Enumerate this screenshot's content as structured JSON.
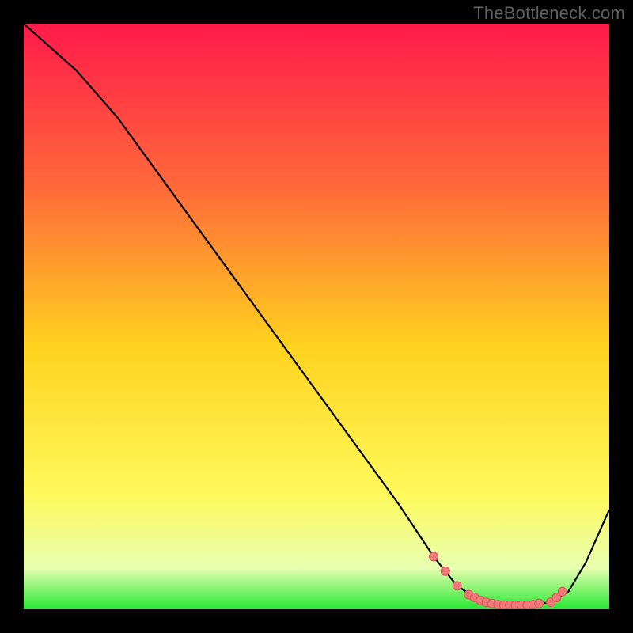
{
  "watermark": "TheBottleneck.com",
  "colors": {
    "gradient_top": "#ff1a4a",
    "gradient_mid_upper": "#ff6a3a",
    "gradient_mid": "#ffd21f",
    "gradient_lower": "#fff95a",
    "gradient_band_light": "#e7ffb0",
    "gradient_bottom": "#27e833",
    "curve": "#000000",
    "marker_fill": "#f07878",
    "marker_stroke": "#d85a5a"
  },
  "chart_data": {
    "type": "line",
    "title": "",
    "xlabel": "",
    "ylabel": "",
    "xlim": [
      0,
      100
    ],
    "ylim": [
      0,
      100
    ],
    "series": [
      {
        "name": "curve",
        "x": [
          0,
          9,
          16,
          24,
          32,
          40,
          48,
          56,
          64,
          70,
          74,
          78,
          82,
          86,
          90,
          93,
          96,
          100
        ],
        "y": [
          100,
          92,
          84,
          73,
          62,
          51,
          40,
          29,
          18,
          9,
          4,
          1.5,
          0.7,
          0.7,
          1.2,
          3,
          8,
          17
        ]
      }
    ],
    "markers": {
      "name": "highlight-points",
      "x": [
        70,
        72,
        74,
        76,
        77,
        78,
        79,
        80,
        81,
        82,
        83,
        84,
        85,
        86,
        87,
        88,
        90,
        91,
        92
      ],
      "y": [
        9,
        6.5,
        4,
        2.5,
        2,
        1.5,
        1.2,
        1,
        0.8,
        0.7,
        0.7,
        0.7,
        0.7,
        0.7,
        0.8,
        1,
        1.2,
        2,
        3
      ]
    }
  }
}
